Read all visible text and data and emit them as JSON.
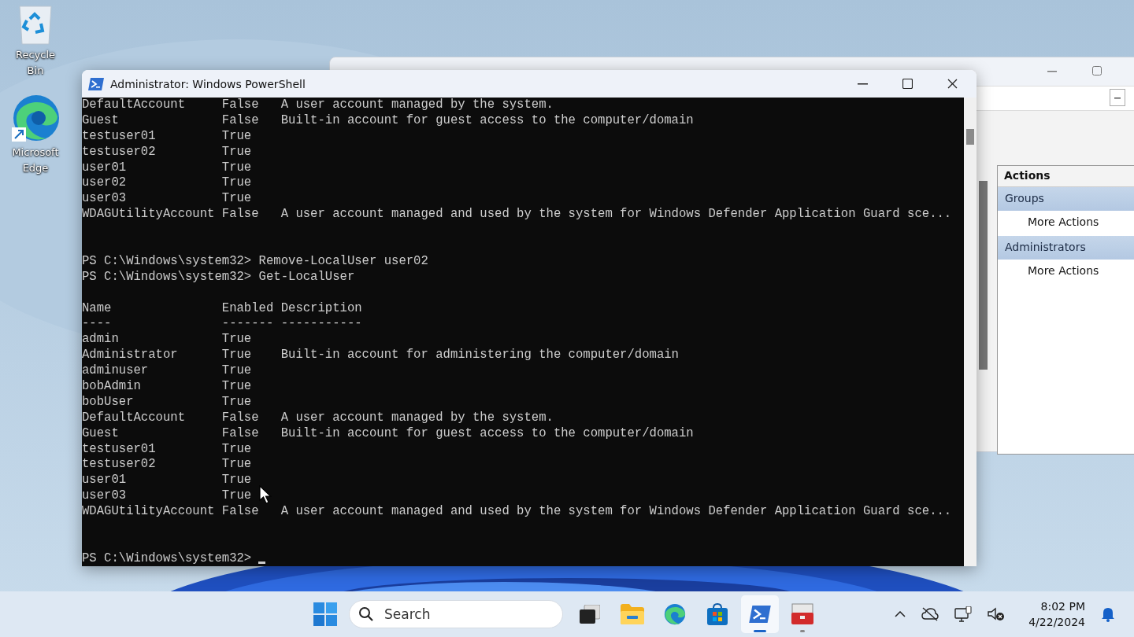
{
  "desktop_icons": [
    {
      "label": "Recycle Bin",
      "kind": "recycle-bin"
    },
    {
      "label": "Microsoft Edge",
      "kind": "edge"
    }
  ],
  "back_window": {
    "actions_pane": {
      "title": "Actions",
      "sections": [
        {
          "title": "Groups",
          "items": [
            "More Actions"
          ]
        },
        {
          "title": "Administrators",
          "items": [
            "More Actions"
          ]
        }
      ]
    }
  },
  "powershell": {
    "title": "Administrator: Windows PowerShell",
    "lines": [
      {
        "kind": "output",
        "text": "DefaultAccount     False   A user account managed by the system."
      },
      {
        "kind": "output",
        "text": "Guest              False   Built-in account for guest access to the computer/domain"
      },
      {
        "kind": "output",
        "text": "testuser01         True"
      },
      {
        "kind": "output",
        "text": "testuser02         True"
      },
      {
        "kind": "output",
        "text": "user01             True"
      },
      {
        "kind": "output",
        "text": "user02             True"
      },
      {
        "kind": "output",
        "text": "user03             True"
      },
      {
        "kind": "output",
        "text": "WDAGUtilityAccount False   A user account managed and used by the system for Windows Defender Application Guard sce..."
      },
      {
        "kind": "blank"
      },
      {
        "kind": "blank"
      },
      {
        "kind": "prompt",
        "prompt": "PS C:\\Windows\\system32>",
        "command": "Remove-LocalUser user02"
      },
      {
        "kind": "prompt",
        "prompt": "PS C:\\Windows\\system32>",
        "command": "Get-LocalUser"
      },
      {
        "kind": "blank"
      },
      {
        "kind": "output",
        "text": "Name               Enabled Description"
      },
      {
        "kind": "output",
        "text": "----               ------- -----------"
      },
      {
        "kind": "output",
        "text": "admin              True"
      },
      {
        "kind": "output",
        "text": "Administrator      True    Built-in account for administering the computer/domain"
      },
      {
        "kind": "output",
        "text": "adminuser          True"
      },
      {
        "kind": "output",
        "text": "bobAdmin           True"
      },
      {
        "kind": "output",
        "text": "bobUser            True"
      },
      {
        "kind": "output",
        "text": "DefaultAccount     False   A user account managed by the system."
      },
      {
        "kind": "output",
        "text": "Guest              False   Built-in account for guest access to the computer/domain"
      },
      {
        "kind": "output",
        "text": "testuser01         True"
      },
      {
        "kind": "output",
        "text": "testuser02         True"
      },
      {
        "kind": "output",
        "text": "user01             True"
      },
      {
        "kind": "output",
        "text": "user03             True"
      },
      {
        "kind": "output",
        "text": "WDAGUtilityAccount False   A user account managed and used by the system for Windows Defender Application Guard sce..."
      },
      {
        "kind": "blank"
      },
      {
        "kind": "blank"
      },
      {
        "kind": "prompt",
        "prompt": "PS C:\\Windows\\system32>",
        "cursor": true
      }
    ]
  },
  "taskbar": {
    "search": {
      "placeholder": "Search"
    },
    "apps": [
      {
        "kind": "task-view",
        "selected": false,
        "running": false
      },
      {
        "kind": "explorer",
        "selected": false,
        "running": false
      },
      {
        "kind": "edge",
        "selected": false,
        "running": false
      },
      {
        "kind": "store",
        "selected": false,
        "running": false
      },
      {
        "kind": "powershell",
        "selected": true,
        "running": true
      },
      {
        "kind": "toolbox",
        "selected": false,
        "running": true
      }
    ],
    "clock": {
      "time": "8:02 PM",
      "date": "4/22/2024"
    }
  }
}
